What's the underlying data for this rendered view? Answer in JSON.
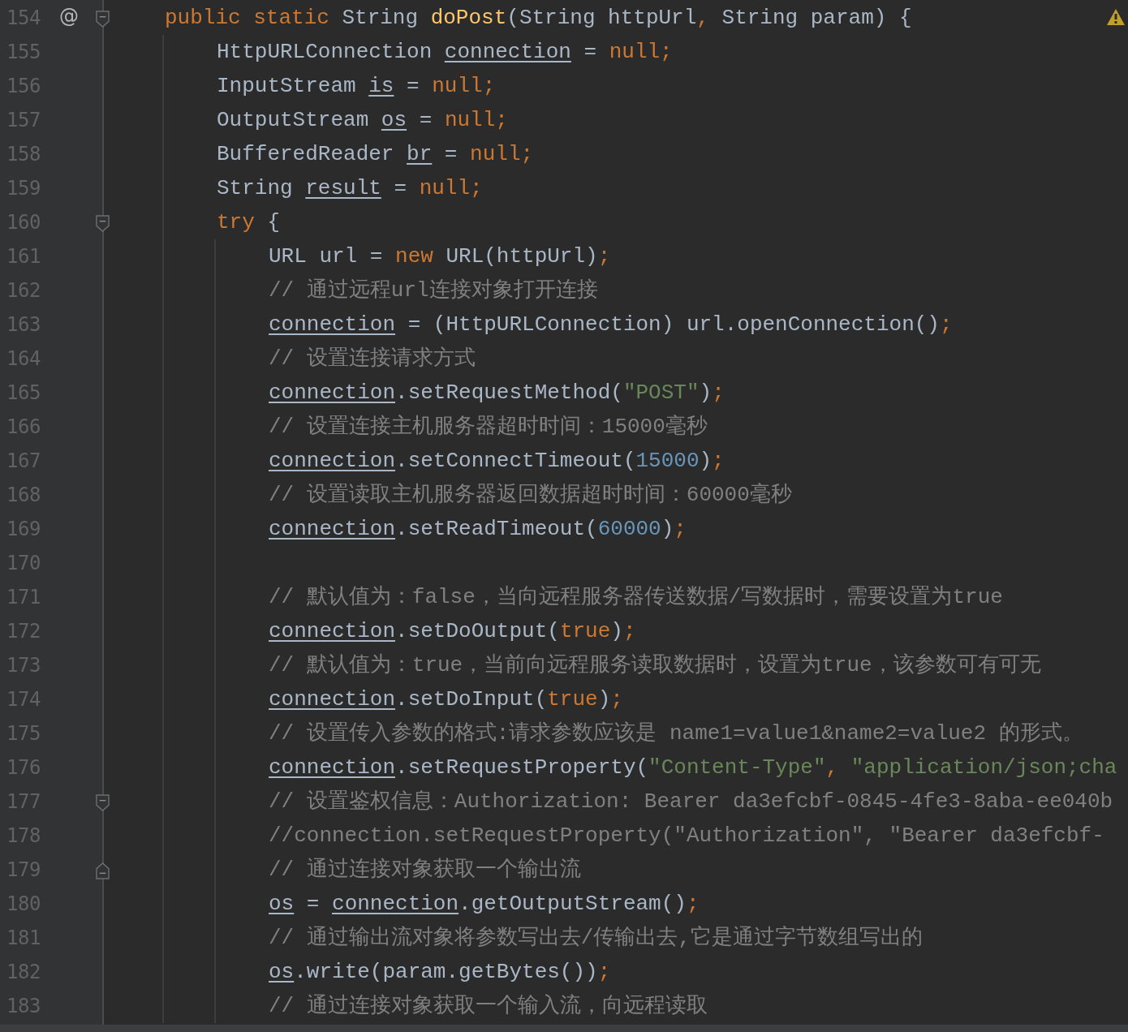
{
  "editor": {
    "lines": [
      {
        "number": "154",
        "gutter_mark": "@",
        "foldable": true,
        "tokens": [
          {
            "kind": "keyword",
            "text": "public static "
          },
          {
            "kind": "plain",
            "text": "String "
          },
          {
            "kind": "declaration",
            "text": "doPost"
          },
          {
            "kind": "plain",
            "text": "(String httpUrl"
          },
          {
            "kind": "keyword",
            "text": ","
          },
          {
            "kind": "plain",
            "text": " String param) {"
          }
        ],
        "children": [
          {
            "number": "155",
            "tokens": [
              {
                "kind": "plain",
                "text": "HttpURLConnection "
              },
              {
                "kind": "variable",
                "text": "connection"
              },
              {
                "kind": "plain",
                "text": " = "
              },
              {
                "kind": "keyword",
                "text": "null;"
              }
            ]
          },
          {
            "number": "156",
            "tokens": [
              {
                "kind": "plain",
                "text": "InputStream "
              },
              {
                "kind": "variable",
                "text": "is"
              },
              {
                "kind": "plain",
                "text": " = "
              },
              {
                "kind": "keyword",
                "text": "null;"
              }
            ]
          },
          {
            "number": "157",
            "tokens": [
              {
                "kind": "plain",
                "text": "OutputStream "
              },
              {
                "kind": "variable",
                "text": "os"
              },
              {
                "kind": "plain",
                "text": " = "
              },
              {
                "kind": "keyword",
                "text": "null;"
              }
            ]
          },
          {
            "number": "158",
            "tokens": [
              {
                "kind": "plain",
                "text": "BufferedReader "
              },
              {
                "kind": "variable",
                "text": "br"
              },
              {
                "kind": "plain",
                "text": " = "
              },
              {
                "kind": "keyword",
                "text": "null;"
              }
            ]
          },
          {
            "number": "159",
            "tokens": [
              {
                "kind": "plain",
                "text": "String "
              },
              {
                "kind": "variable",
                "text": "result"
              },
              {
                "kind": "plain",
                "text": " = "
              },
              {
                "kind": "keyword",
                "text": "null;"
              }
            ]
          },
          {
            "number": "160",
            "foldable": true,
            "tokens": [
              {
                "kind": "keyword",
                "text": "try"
              },
              {
                "kind": "plain",
                "text": " {"
              }
            ],
            "children": [
              {
                "number": "161",
                "tokens": [
                  {
                    "kind": "plain",
                    "text": "URL url = "
                  },
                  {
                    "kind": "keyword",
                    "text": "new"
                  },
                  {
                    "kind": "plain",
                    "text": " URL(httpUrl)"
                  },
                  {
                    "kind": "keyword",
                    "text": ";"
                  }
                ]
              },
              {
                "number": "162",
                "tokens": [
                  {
                    "kind": "comment",
                    "text": "// 通过远程url连接对象打开连接"
                  }
                ]
              },
              {
                "number": "163",
                "tokens": [
                  {
                    "kind": "variable",
                    "text": "connection"
                  },
                  {
                    "kind": "plain",
                    "text": " = (HttpURLConnection) url.openConnection()"
                  },
                  {
                    "kind": "keyword",
                    "text": ";"
                  }
                ]
              },
              {
                "number": "164",
                "tokens": [
                  {
                    "kind": "comment",
                    "text": "// 设置连接请求方式"
                  }
                ]
              },
              {
                "number": "165",
                "tokens": [
                  {
                    "kind": "variable",
                    "text": "connection"
                  },
                  {
                    "kind": "plain",
                    "text": ".setRequestMethod("
                  },
                  {
                    "kind": "string",
                    "text": "\"POST\""
                  },
                  {
                    "kind": "plain",
                    "text": ")"
                  },
                  {
                    "kind": "keyword",
                    "text": ";"
                  }
                ]
              },
              {
                "number": "166",
                "tokens": [
                  {
                    "kind": "comment",
                    "text": "// 设置连接主机服务器超时时间：15000毫秒"
                  }
                ]
              },
              {
                "number": "167",
                "tokens": [
                  {
                    "kind": "variable",
                    "text": "connection"
                  },
                  {
                    "kind": "plain",
                    "text": ".setConnectTimeout("
                  },
                  {
                    "kind": "number",
                    "text": "15000"
                  },
                  {
                    "kind": "plain",
                    "text": ")"
                  },
                  {
                    "kind": "keyword",
                    "text": ";"
                  }
                ]
              },
              {
                "number": "168",
                "tokens": [
                  {
                    "kind": "comment",
                    "text": "// 设置读取主机服务器返回数据超时时间：60000毫秒"
                  }
                ]
              },
              {
                "number": "169",
                "tokens": [
                  {
                    "kind": "variable",
                    "text": "connection"
                  },
                  {
                    "kind": "plain",
                    "text": ".setReadTimeout("
                  },
                  {
                    "kind": "number",
                    "text": "60000"
                  },
                  {
                    "kind": "plain",
                    "text": ")"
                  },
                  {
                    "kind": "keyword",
                    "text": ";"
                  }
                ]
              },
              {
                "number": "170"
              },
              {
                "number": "171",
                "tokens": [
                  {
                    "kind": "comment",
                    "text": "// 默认值为：false，当向远程服务器传送数据/写数据时，需要设置为true"
                  }
                ]
              },
              {
                "number": "172",
                "tokens": [
                  {
                    "kind": "variable",
                    "text": "connection"
                  },
                  {
                    "kind": "plain",
                    "text": ".setDoOutput("
                  },
                  {
                    "kind": "keyword",
                    "text": "true"
                  },
                  {
                    "kind": "plain",
                    "text": ")"
                  },
                  {
                    "kind": "keyword",
                    "text": ";"
                  }
                ]
              },
              {
                "number": "173",
                "tokens": [
                  {
                    "kind": "comment",
                    "text": "// 默认值为：true，当前向远程服务读取数据时，设置为true，该参数可有可无"
                  }
                ]
              },
              {
                "number": "174",
                "tokens": [
                  {
                    "kind": "variable",
                    "text": "connection"
                  },
                  {
                    "kind": "plain",
                    "text": ".setDoInput("
                  },
                  {
                    "kind": "keyword",
                    "text": "true"
                  },
                  {
                    "kind": "plain",
                    "text": ")"
                  },
                  {
                    "kind": "keyword",
                    "text": ";"
                  }
                ]
              },
              {
                "number": "175",
                "tokens": [
                  {
                    "kind": "comment",
                    "text": "// 设置传入参数的格式:请求参数应该是 name1=value1&name2=value2 的形式。"
                  }
                ]
              },
              {
                "number": "176",
                "tokens": [
                  {
                    "kind": "variable",
                    "text": "connection"
                  },
                  {
                    "kind": "plain",
                    "text": ".setRequestProperty("
                  },
                  {
                    "kind": "string",
                    "text": "\"Content-Type\""
                  },
                  {
                    "kind": "keyword",
                    "text": ", "
                  },
                  {
                    "kind": "string",
                    "text": "\"application/json;cha"
                  }
                ]
              },
              {
                "number": "177",
                "foldable": true,
                "tokens": [
                  {
                    "kind": "comment",
                    "text": "// 设置鉴权信息：Authorization: Bearer da3efcbf-0845-4fe3-8aba-ee040b"
                  }
                ]
              },
              {
                "number": "178",
                "tokens": [
                  {
                    "kind": "comment",
                    "text": "//connection.setRequestProperty(\"Authorization\", \"Bearer da3efcbf-"
                  }
                ]
              },
              {
                "number": "179",
                "fold_end": true,
                "tokens": [
                  {
                    "kind": "comment",
                    "text": "// 通过连接对象获取一个输出流"
                  }
                ]
              },
              {
                "number": "180",
                "tokens": [
                  {
                    "kind": "variable",
                    "text": "os"
                  },
                  {
                    "kind": "plain",
                    "text": " = "
                  },
                  {
                    "kind": "variable",
                    "text": "connection"
                  },
                  {
                    "kind": "plain",
                    "text": ".getOutputStream()"
                  },
                  {
                    "kind": "keyword",
                    "text": ";"
                  }
                ]
              },
              {
                "number": "181",
                "tokens": [
                  {
                    "kind": "comment",
                    "text": "// 通过输出流对象将参数写出去/传输出去,它是通过字节数组写出的"
                  }
                ]
              },
              {
                "number": "182",
                "tokens": [
                  {
                    "kind": "variable",
                    "text": "os"
                  },
                  {
                    "kind": "plain",
                    "text": ".write(param.getBytes())"
                  },
                  {
                    "kind": "keyword",
                    "text": ";"
                  }
                ]
              },
              {
                "number": "183",
                "tokens": [
                  {
                    "kind": "comment",
                    "text": "// 通过连接对象获取一个输入流，向远程读取"
                  }
                ]
              }
            ]
          }
        ]
      }
    ]
  }
}
